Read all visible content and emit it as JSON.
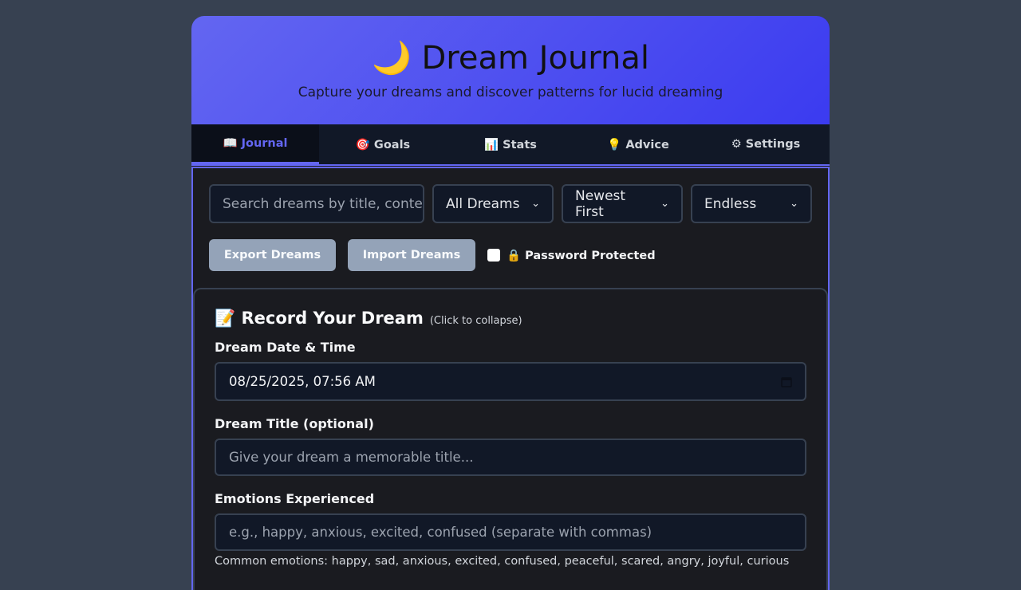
{
  "header": {
    "title": "🌙 Dream Journal",
    "subtitle": "Capture your dreams and discover patterns for lucid dreaming"
  },
  "tabs": [
    {
      "label": "📖 Journal",
      "active": true
    },
    {
      "label": "🎯 Goals",
      "active": false
    },
    {
      "label": "📊 Stats",
      "active": false
    },
    {
      "label": "💡 Advice",
      "active": false
    },
    {
      "label": "⚙ Settings",
      "active": false
    }
  ],
  "controls": {
    "search_placeholder": "Search dreams by title, content...",
    "filter_value": "All Dreams",
    "sort_value": "Newest First",
    "mode_value": "Endless"
  },
  "actions": {
    "export_label": "Export Dreams",
    "import_label": "Import Dreams",
    "password_label": "🔒 Password Protected",
    "password_checked": false
  },
  "record_form": {
    "title": "📝 Record Your Dream",
    "collapse_hint": "(Click to collapse)",
    "date_label": "Dream Date & Time",
    "date_value": "08/25/2025, 07:56 AM",
    "title_label": "Dream Title (optional)",
    "title_placeholder": "Give your dream a memorable title...",
    "emotions_label": "Emotions Experienced",
    "emotions_placeholder": "e.g., happy, anxious, excited, confused (separate with commas)",
    "emotions_hint": "Common emotions: happy, sad, anxious, excited, confused, peaceful, scared, angry, joyful, curious"
  },
  "colors": {
    "accent": "#6366f1",
    "background": "#374151",
    "panel": "#1a1b20",
    "button": "#94a3b8"
  }
}
